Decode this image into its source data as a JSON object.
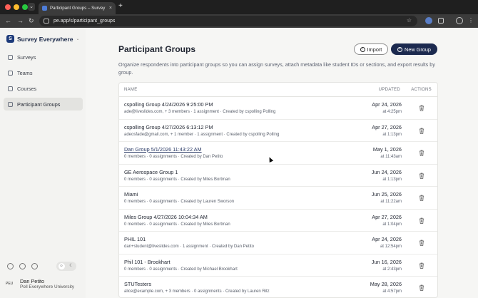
{
  "browser": {
    "tab_title": "Participant Groups – Survey E",
    "url": "pe.app/s/participant_groups"
  },
  "sidebar": {
    "brand": "Survey Everywhere",
    "items": [
      {
        "label": "Surveys",
        "icon": "clipboard-icon"
      },
      {
        "label": "Teams",
        "icon": "team-icon"
      },
      {
        "label": "Courses",
        "icon": "folder-icon"
      },
      {
        "label": "Participant Groups",
        "icon": "people-icon",
        "active": true
      }
    ],
    "user": {
      "initials": "PEU",
      "name": "Dan Petito",
      "org": "Poll Everywhere University"
    }
  },
  "main": {
    "title": "Participant Groups",
    "import_label": "Import",
    "new_group_label": "New Group",
    "description": "Organize respondents into participant groups so you can assign surveys, attach metadata like student IDs or sections, and export results by group.",
    "columns": {
      "name": "NAME",
      "updated": "UPDATED",
      "actions": "ACTIONS"
    },
    "rows": [
      {
        "name": "cspolling Group 4/24/2026 9:25:00 PM",
        "meta": "ade@liveslides.com, + 3 members · 1 assignment · Created by cspolling Polling",
        "date": "Apr 24, 2026",
        "time": "at 4:25pm"
      },
      {
        "name": "cspolling Group 4/27/2026 6:13:12 PM",
        "meta": "adeosfade@gmail.com, + 1 member · 1 assignment · Created by cspolling Polling",
        "date": "Apr 27, 2026",
        "time": "at 1:13pm"
      },
      {
        "name": "Dan Group 5/1/2026 11:43:22 AM",
        "meta": "0 members · 0 assignments · Created by Dan Petito",
        "date": "May 1, 2026",
        "time": "at 11:43am",
        "link": true
      },
      {
        "name": "GE Aerospace Group 1",
        "meta": "0 members · 0 assignments · Created by Miles Bortman",
        "date": "Jun 24, 2026",
        "time": "at 1:13pm"
      },
      {
        "name": "Miami",
        "meta": "0 members · 0 assignments · Created by Lauren Sworson",
        "date": "Jun 25, 2026",
        "time": "at 11:22am"
      },
      {
        "name": "Miles Group 4/27/2026 10:04:34 AM",
        "meta": "0 members · 0 assignments · Created by Miles Bortman",
        "date": "Apr 27, 2026",
        "time": "at 1:04pm"
      },
      {
        "name": "PHIL 101",
        "meta": "dan+student@liveslides.com · 1 assignment · Created by Dan Petito",
        "date": "Apr 24, 2026",
        "time": "at 12:54pm"
      },
      {
        "name": "Phil 101 - Brookhart",
        "meta": "0 members · 0 assignments · Created by Michael Brookhart",
        "date": "Jun 16, 2026",
        "time": "at 2:43pm"
      },
      {
        "name": "STUTesters",
        "meta": "alice@example.com, + 3 members · 0 assignments · Created by Lauren Ritz",
        "date": "May 28, 2026",
        "time": "at 4:57pm"
      }
    ]
  },
  "colors": {
    "accent": "#1c2a4f",
    "page_bg": "#f6f6f4"
  }
}
